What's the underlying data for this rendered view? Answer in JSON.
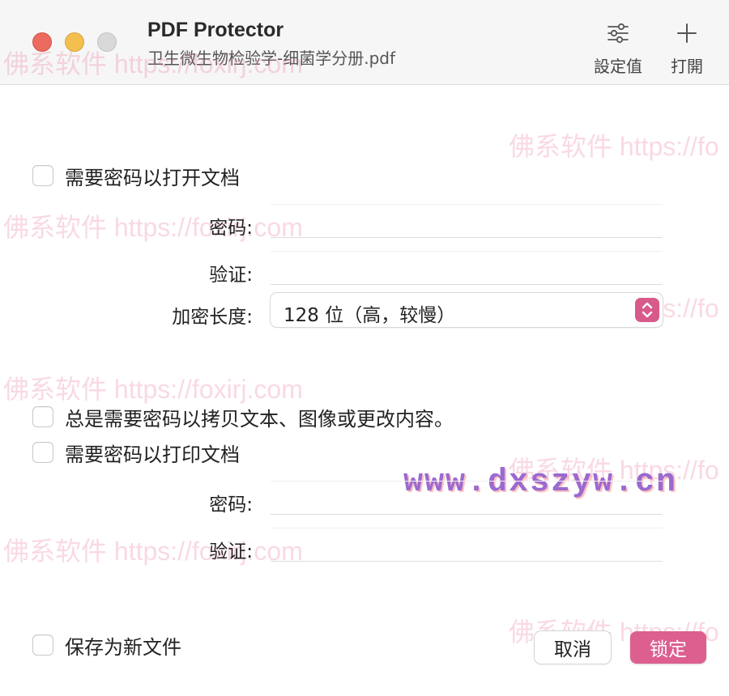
{
  "window": {
    "app_title": "PDF Protector",
    "file_name": "卫生微生物检验学-细菌学分册.pdf",
    "toolbar": {
      "settings_label": "設定值",
      "settings_icon": "sliders-icon",
      "open_label": "打開",
      "open_icon": "plus-icon"
    }
  },
  "open_protection": {
    "checkbox_label": "需要密码以打开文档",
    "checked": false,
    "password_label": "密码:",
    "password_value": "",
    "verify_label": "验证:",
    "verify_value": "",
    "encryption_label": "加密长度:",
    "encryption_value": "128 位（高，较慢）"
  },
  "copy_protection": {
    "checkbox_label": "总是需要密码以拷贝文本、图像或更改内容。",
    "checked": false
  },
  "print_protection": {
    "checkbox_label": "需要密码以打印文档",
    "checked": false,
    "password_label": "密码:",
    "password_value": "",
    "verify_label": "验证:",
    "verify_value": ""
  },
  "footer": {
    "save_new_label": "保存为新文件",
    "save_new_checked": false,
    "cancel_label": "取消",
    "lock_label": "锁定"
  },
  "watermarks": [
    "佛系软件 https://foxirj.com",
    "佛系软件 https://fo",
    "佛系软件 https://foxirj.com",
    "佛系软件 https://fo",
    "佛系软件 https://foxirj.com",
    "佛系软件 https://fo",
    "www.dxszyw.cn",
    "佛系软件 https://foxirj.com",
    "佛系软件 https://fo"
  ],
  "colors": {
    "accent": "#dc5f8f",
    "close": "#ec6a5f",
    "minimize": "#f4bf4f",
    "zoom": "#d9d9d9"
  }
}
